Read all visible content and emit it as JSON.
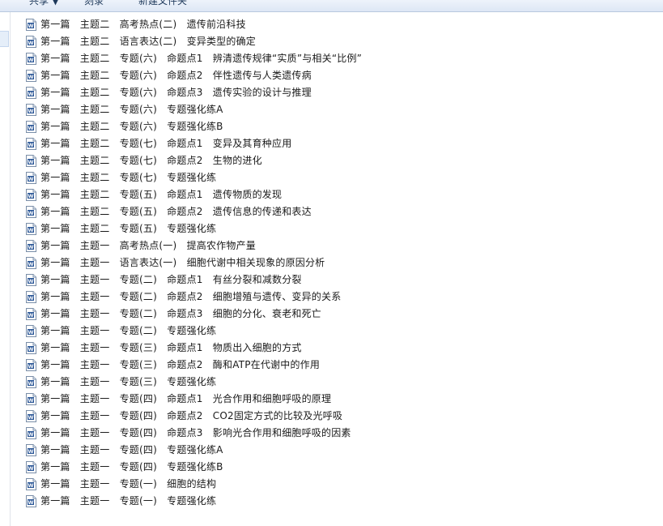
{
  "toolbar": {
    "item1": "共享 ▼",
    "item2": "刻录",
    "item3": "新建文件夹"
  },
  "icon": {
    "name": "word-document-icon",
    "color": "#2b5797"
  },
  "files": [
    "第一篇　主题二　高考热点(二)　遗传前沿科技",
    "第一篇　主题二　语言表达(二)　变异类型的确定",
    "第一篇　主题二　专题(六)　命题点1　辨清遗传规律“实质”与相关“比例”",
    "第一篇　主题二　专题(六)　命题点2　伴性遗传与人类遗传病",
    "第一篇　主题二　专题(六)　命题点3　遗传实验的设计与推理",
    "第一篇　主题二　专题(六)　专题强化练A",
    "第一篇　主题二　专题(六)　专题强化练B",
    "第一篇　主题二　专题(七)　命题点1　变异及其育种应用",
    "第一篇　主题二　专题(七)　命题点2　生物的进化",
    "第一篇　主题二　专题(七)　专题强化练",
    "第一篇　主题二　专题(五)　命题点1　遗传物质的发现",
    "第一篇　主题二　专题(五)　命题点2　遗传信息的传递和表达",
    "第一篇　主题二　专题(五)　专题强化练",
    "第一篇　主题一　高考热点(一)　提高农作物产量",
    "第一篇　主题一　语言表达(一)　细胞代谢中相关现象的原因分析",
    "第一篇　主题一　专题(二)　命题点1　有丝分裂和减数分裂",
    "第一篇　主题一　专题(二)　命题点2　细胞增殖与遗传、变异的关系",
    "第一篇　主题一　专题(二)　命题点3　细胞的分化、衰老和死亡",
    "第一篇　主题一　专题(二)　专题强化练",
    "第一篇　主题一　专题(三)　命题点1　物质出入细胞的方式",
    "第一篇　主题一　专题(三)　命题点2　酶和ATP在代谢中的作用",
    "第一篇　主题一　专题(三)　专题强化练",
    "第一篇　主题一　专题(四)　命题点1　光合作用和细胞呼吸的原理",
    "第一篇　主题一　专题(四)　命题点2　CO2固定方式的比较及光呼吸",
    "第一篇　主题一　专题(四)　命题点3　影响光合作用和细胞呼吸的因素",
    "第一篇　主题一　专题(四)　专题强化练A",
    "第一篇　主题一　专题(四)　专题强化练B",
    "第一篇　主题一　专题(一)　细胞的结构",
    "第一篇　主题一　专题(一)　专题强化练"
  ]
}
